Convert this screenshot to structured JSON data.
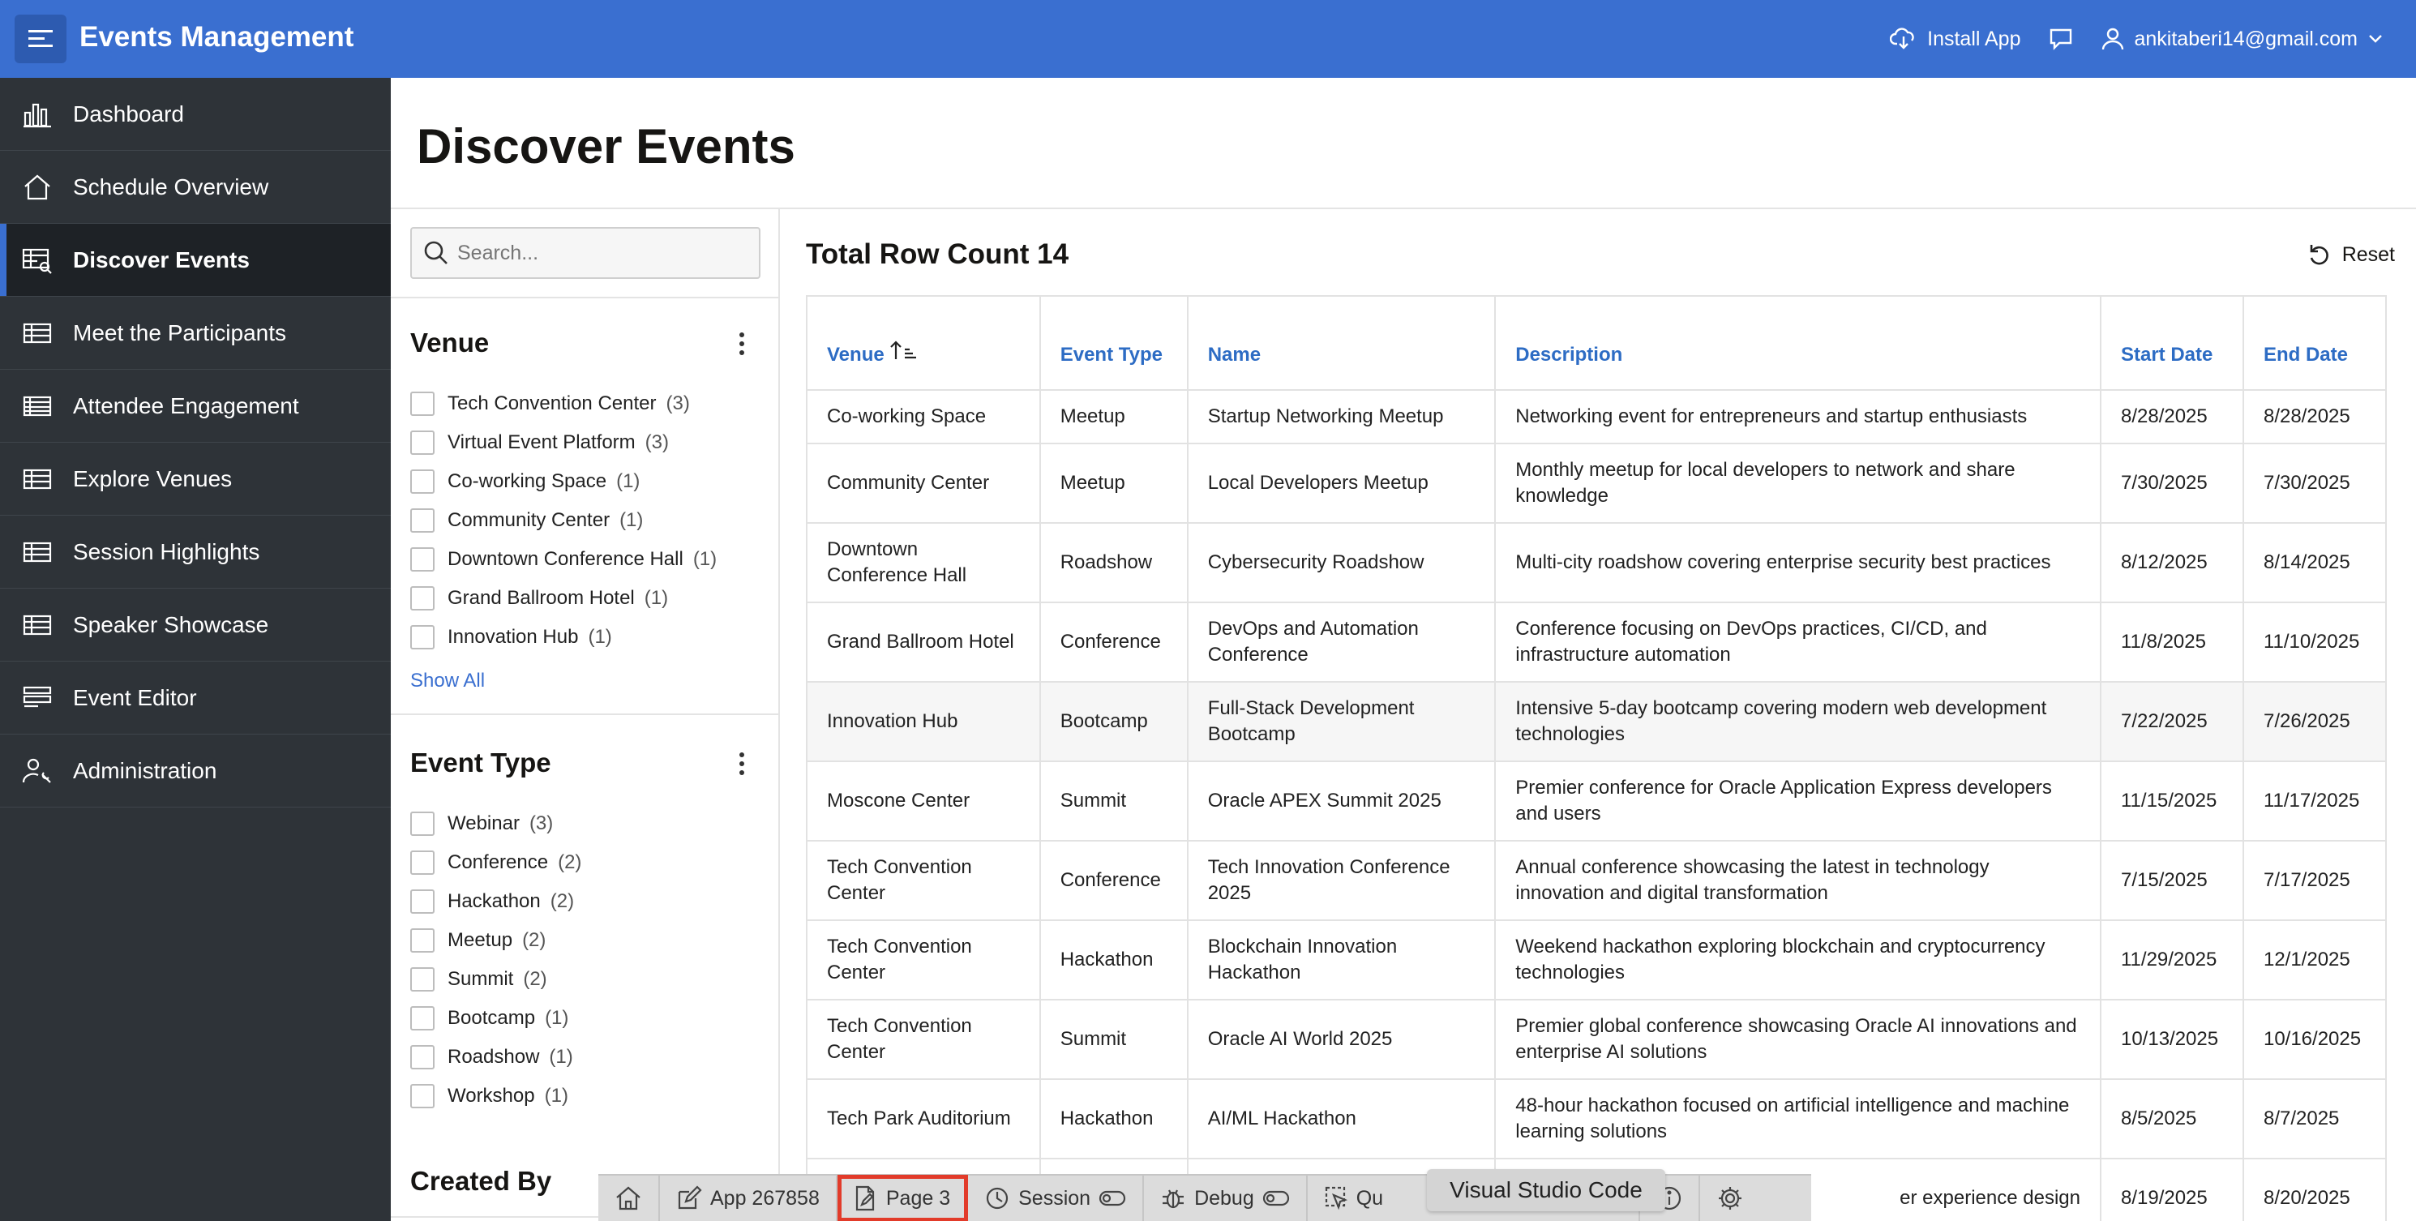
{
  "header": {
    "app_title": "Events Management",
    "install_app": "Install App",
    "user_email": "ankitaberi14@gmail.com"
  },
  "sidebar": {
    "items": [
      {
        "label": "Dashboard",
        "icon": "bar-chart-icon"
      },
      {
        "label": "Schedule Overview",
        "icon": "home-icon"
      },
      {
        "label": "Discover Events",
        "icon": "table-search-icon",
        "active": true
      },
      {
        "label": "Meet the Participants",
        "icon": "grid-icon"
      },
      {
        "label": "Attendee Engagement",
        "icon": "table-icon"
      },
      {
        "label": "Explore Venues",
        "icon": "grid-icon"
      },
      {
        "label": "Session Highlights",
        "icon": "grid-icon"
      },
      {
        "label": "Speaker Showcase",
        "icon": "grid-icon"
      },
      {
        "label": "Event Editor",
        "icon": "form-icon"
      },
      {
        "label": "Administration",
        "icon": "user-wrench-icon"
      }
    ]
  },
  "main": {
    "page_title": "Discover Events"
  },
  "facets": {
    "search_placeholder": "Search...",
    "venue": {
      "title": "Venue",
      "items": [
        {
          "label": "Tech Convention Center",
          "count": "(3)"
        },
        {
          "label": "Virtual Event Platform",
          "count": "(3)"
        },
        {
          "label": "Co-working Space",
          "count": "(1)"
        },
        {
          "label": "Community Center",
          "count": "(1)"
        },
        {
          "label": "Downtown Conference Hall",
          "count": "(1)"
        },
        {
          "label": "Grand Ballroom Hotel",
          "count": "(1)"
        },
        {
          "label": "Innovation Hub",
          "count": "(1)"
        }
      ],
      "show_all": "Show All"
    },
    "event_type": {
      "title": "Event Type",
      "items": [
        {
          "label": "Webinar",
          "count": "(3)"
        },
        {
          "label": "Conference",
          "count": "(2)"
        },
        {
          "label": "Hackathon",
          "count": "(2)"
        },
        {
          "label": "Meetup",
          "count": "(2)"
        },
        {
          "label": "Summit",
          "count": "(2)"
        },
        {
          "label": "Bootcamp",
          "count": "(1)"
        },
        {
          "label": "Roadshow",
          "count": "(1)"
        },
        {
          "label": "Workshop",
          "count": "(1)"
        }
      ]
    },
    "created_by": {
      "title": "Created By"
    }
  },
  "report": {
    "row_count": "Total Row Count 14",
    "reset": "Reset",
    "columns": [
      "Venue",
      "Event Type",
      "Name",
      "Description",
      "Start Date",
      "End Date"
    ],
    "rows": [
      [
        "Co-working Space",
        "Meetup",
        "Startup Networking Meetup",
        "Networking event for entrepreneurs and startup enthusiasts",
        "8/28/2025",
        "8/28/2025"
      ],
      [
        "Community Center",
        "Meetup",
        "Local Developers Meetup",
        "Monthly meetup for local developers to network and share knowledge",
        "7/30/2025",
        "7/30/2025"
      ],
      [
        "Downtown Conference Hall",
        "Roadshow",
        "Cybersecurity Roadshow",
        "Multi-city roadshow covering enterprise security best practices",
        "8/12/2025",
        "8/14/2025"
      ],
      [
        "Grand Ballroom Hotel",
        "Conference",
        "DevOps and Automation Conference",
        "Conference focusing on DevOps practices, CI/CD, and infrastructure automation",
        "11/8/2025",
        "11/10/2025"
      ],
      [
        "Innovation Hub",
        "Bootcamp",
        "Full-Stack Development Bootcamp",
        "Intensive 5-day bootcamp covering modern web development technologies",
        "7/22/2025",
        "7/26/2025"
      ],
      [
        "Moscone Center",
        "Summit",
        "Oracle APEX Summit 2025",
        "Premier conference for Oracle Application Express developers and users",
        "11/15/2025",
        "11/17/2025"
      ],
      [
        "Tech Convention Center",
        "Conference",
        "Tech Innovation Conference 2025",
        "Annual conference showcasing the latest in technology innovation and digital transformation",
        "7/15/2025",
        "7/17/2025"
      ],
      [
        "Tech Convention Center",
        "Hackathon",
        "Blockchain Innovation Hackathon",
        "Weekend hackathon exploring blockchain and cryptocurrency technologies",
        "11/29/2025",
        "12/1/2025"
      ],
      [
        "Tech Convention Center",
        "Summit",
        "Oracle AI World 2025",
        "Premier global conference showcasing Oracle AI innovations and enterprise AI solutions",
        "10/13/2025",
        "10/16/2025"
      ],
      [
        "Tech Park Auditorium",
        "Hackathon",
        "AI/ML Hackathon",
        "48-hour hackathon focused on artificial intelligence and machine learning solutions",
        "8/5/2025",
        "8/7/2025"
      ],
      [
        "",
        "",
        "",
        "er experience design",
        "8/19/2025",
        "8/20/2025"
      ]
    ]
  },
  "devbar": {
    "app": "App 267858",
    "page": "Page 3",
    "session": "Session",
    "debug": "Debug",
    "quick": "Qu",
    "tooltip": "Visual Studio Code"
  }
}
